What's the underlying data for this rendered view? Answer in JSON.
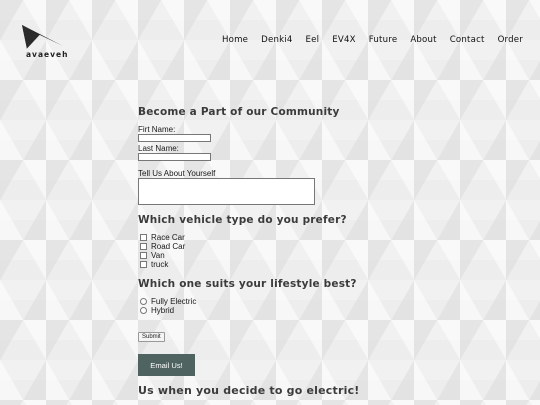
{
  "brand": {
    "name": "avaeveh"
  },
  "nav": {
    "items": [
      "Home",
      "Denki4",
      "Eel",
      "EV4X",
      "Future",
      "About",
      "Contact",
      "Order"
    ]
  },
  "form": {
    "heading": "Become a Part of our Community",
    "first_name_label": "Firt Name:",
    "first_name_value": "",
    "last_name_label": "Last Name:",
    "last_name_value": "",
    "about_label": "Tell Us About Yourself",
    "about_value": "",
    "vehicle_question": "Which vehicle type do you prefer?",
    "vehicle_options": [
      {
        "label": "Race Car",
        "checked": false
      },
      {
        "label": "Road Car",
        "checked": false
      },
      {
        "label": "Van",
        "checked": false
      },
      {
        "label": "truck",
        "checked": false
      }
    ],
    "lifestyle_question": "Which one suits your lifestyle best?",
    "lifestyle_options": [
      {
        "label": "Fully Electric",
        "selected": false
      },
      {
        "label": "Hybrid",
        "selected": false
      }
    ],
    "submit_label": "Submit",
    "email_button_label": "Email Us!"
  },
  "footer_cta": "Us when you decide to go electric!",
  "colors": {
    "email_button_bg": "#4f6361",
    "heading_text": "#3b3b3b",
    "page_bg": "#f1f1f1"
  }
}
